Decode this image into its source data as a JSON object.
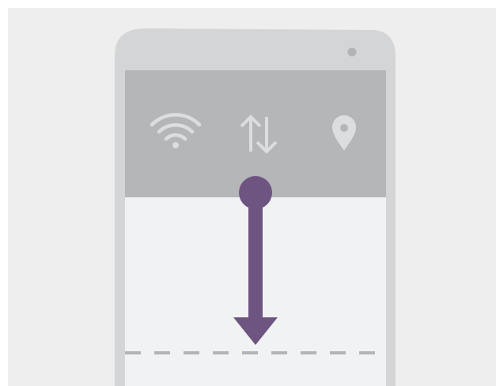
{
  "illustration": {
    "colors": {
      "outer_border": "#ffffff",
      "canvas_background": "#eeeeee",
      "phone_frame": "#d4d5d6",
      "camera_dot": "#b3b4b6",
      "quick_settings_panel": "#b5b6b8",
      "quick_settings_icons": "#dcdddf",
      "screen_content": "#f1f2f4",
      "swipe_arrow": "#6e5581",
      "dashed_line": "#b3b4b6"
    },
    "quick_settings_icons": [
      "wifi-icon",
      "data-transfer-icon",
      "location-pin-icon"
    ],
    "gesture": "swipe-down-from-top"
  }
}
